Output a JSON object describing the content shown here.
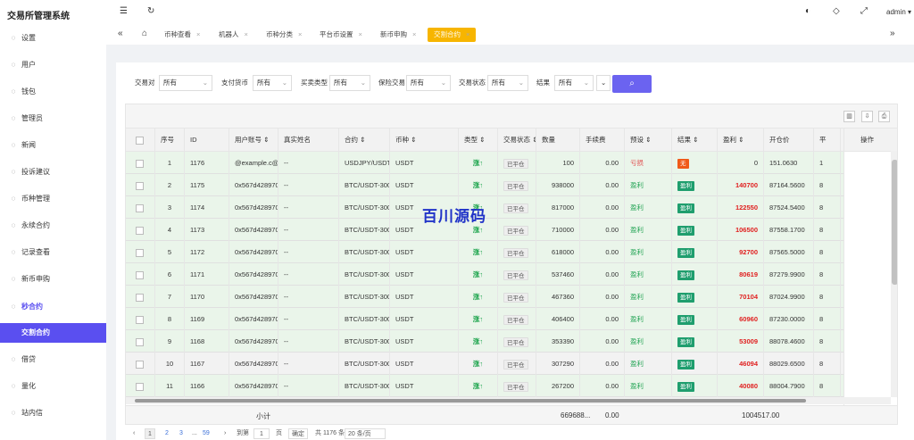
{
  "app": {
    "title": "交易所管理系统",
    "user": "admin"
  },
  "sidebar": {
    "items": [
      {
        "label": "设置",
        "icon": "gear-icon"
      },
      {
        "label": "用户",
        "icon": "user-icon"
      },
      {
        "label": "钱包",
        "icon": "wallet-icon"
      },
      {
        "label": "管理员",
        "icon": "shield-icon"
      },
      {
        "label": "新闻",
        "icon": "news-icon"
      },
      {
        "label": "投诉建议",
        "icon": "feedback-icon"
      },
      {
        "label": "币种管理",
        "icon": "coin-icon"
      },
      {
        "label": "永续合约",
        "icon": "contract-icon"
      },
      {
        "label": "记录查看",
        "icon": "record-icon"
      },
      {
        "label": "新币申购",
        "icon": "newcoin-icon"
      },
      {
        "label": "秒合约",
        "icon": "clock-icon"
      },
      {
        "label": "交割合约",
        "icon": ""
      },
      {
        "label": "借贷",
        "icon": "loan-icon"
      },
      {
        "label": "量化",
        "icon": "quant-icon"
      },
      {
        "label": "站内信",
        "icon": "mail-icon"
      }
    ]
  },
  "tabs": [
    {
      "label": "币种查看"
    },
    {
      "label": "机器人"
    },
    {
      "label": "币种分类"
    },
    {
      "label": "平台币设置"
    },
    {
      "label": "新币申购"
    },
    {
      "label": "交割合约"
    }
  ],
  "filters": [
    {
      "label": "交易对",
      "value": "所有"
    },
    {
      "label": "支付货币",
      "value": "所有"
    },
    {
      "label": "买卖类型",
      "value": "所有"
    },
    {
      "label": "保险交易",
      "value": "所有"
    },
    {
      "label": "交易状态",
      "value": "所有"
    },
    {
      "label": "结果",
      "value": "所有"
    }
  ],
  "table": {
    "columns": [
      "序号",
      "ID",
      "用户账号 ⇕",
      "真实姓名",
      "合约 ⇕",
      "币种 ⇕",
      "类型 ⇕",
      "交易状态 ⇕",
      "数量",
      "手续费",
      "预设 ⇕",
      "结果 ⇕",
      "盈利 ⇕",
      "开仓价",
      "平"
    ],
    "op_column": "操作",
    "rows": [
      {
        "n": "1",
        "id": "1176",
        "user": "@example.c@...",
        "name": "--",
        "contract": "USDJPY/USDT-...",
        "coin": "USDT",
        "type": "涨↑",
        "status": "已平仓",
        "qty": "100",
        "fee": "0.00",
        "preset": "亏损",
        "result": "无",
        "profit": "0",
        "open": "151.0630",
        "close": "1"
      },
      {
        "n": "2",
        "id": "1175",
        "user": "0x567d428970...",
        "name": "--",
        "contract": "BTC/USDT-300",
        "coin": "USDT",
        "type": "涨↑",
        "status": "已平仓",
        "qty": "938000",
        "fee": "0.00",
        "preset": "盈利",
        "result": "盈利",
        "profit": "140700",
        "open": "87164.5600",
        "close": "8"
      },
      {
        "n": "3",
        "id": "1174",
        "user": "0x567d428970...",
        "name": "--",
        "contract": "BTC/USDT-300",
        "coin": "USDT",
        "type": "涨↑",
        "status": "已平仓",
        "qty": "817000",
        "fee": "0.00",
        "preset": "盈利",
        "result": "盈利",
        "profit": "122550",
        "open": "87524.5400",
        "close": "8"
      },
      {
        "n": "4",
        "id": "1173",
        "user": "0x567d428970...",
        "name": "--",
        "contract": "BTC/USDT-300",
        "coin": "USDT",
        "type": "涨↑",
        "status": "已平仓",
        "qty": "710000",
        "fee": "0.00",
        "preset": "盈利",
        "result": "盈利",
        "profit": "106500",
        "open": "87558.1700",
        "close": "8"
      },
      {
        "n": "5",
        "id": "1172",
        "user": "0x567d428970...",
        "name": "--",
        "contract": "BTC/USDT-300",
        "coin": "USDT",
        "type": "涨↑",
        "status": "已平仓",
        "qty": "618000",
        "fee": "0.00",
        "preset": "盈利",
        "result": "盈利",
        "profit": "92700",
        "open": "87565.5000",
        "close": "8"
      },
      {
        "n": "6",
        "id": "1171",
        "user": "0x567d428970...",
        "name": "--",
        "contract": "BTC/USDT-300",
        "coin": "USDT",
        "type": "涨↑",
        "status": "已平仓",
        "qty": "537460",
        "fee": "0.00",
        "preset": "盈利",
        "result": "盈利",
        "profit": "80619",
        "open": "87279.9900",
        "close": "8"
      },
      {
        "n": "7",
        "id": "1170",
        "user": "0x567d428970...",
        "name": "--",
        "contract": "BTC/USDT-300",
        "coin": "USDT",
        "type": "涨↑",
        "status": "已平仓",
        "qty": "467360",
        "fee": "0.00",
        "preset": "盈利",
        "result": "盈利",
        "profit": "70104",
        "open": "87024.9900",
        "close": "8"
      },
      {
        "n": "8",
        "id": "1169",
        "user": "0x567d428970...",
        "name": "--",
        "contract": "BTC/USDT-300",
        "coin": "USDT",
        "type": "涨↑",
        "status": "已平仓",
        "qty": "406400",
        "fee": "0.00",
        "preset": "盈利",
        "result": "盈利",
        "profit": "60960",
        "open": "87230.0000",
        "close": "8"
      },
      {
        "n": "9",
        "id": "1168",
        "user": "0x567d428970...",
        "name": "--",
        "contract": "BTC/USDT-300",
        "coin": "USDT",
        "type": "涨↑",
        "status": "已平仓",
        "qty": "353390",
        "fee": "0.00",
        "preset": "盈利",
        "result": "盈利",
        "profit": "53009",
        "open": "88078.4600",
        "close": "8"
      },
      {
        "n": "10",
        "id": "1167",
        "user": "0x567d428970...",
        "name": "--",
        "contract": "BTC/USDT-300",
        "coin": "USDT",
        "type": "涨↑",
        "status": "已平仓",
        "qty": "307290",
        "fee": "0.00",
        "preset": "盈利",
        "result": "盈利",
        "profit": "46094",
        "open": "88029.6500",
        "close": "8"
      },
      {
        "n": "11",
        "id": "1166",
        "user": "0x567d428970...",
        "name": "--",
        "contract": "BTC/USDT-300",
        "coin": "USDT",
        "type": "涨↑",
        "status": "已平仓",
        "qty": "267200",
        "fee": "0.00",
        "preset": "盈利",
        "result": "盈利",
        "profit": "40080",
        "open": "88004.7900",
        "close": "8"
      }
    ],
    "totals": {
      "label": "小计",
      "qty": "669688...",
      "fee": "0.00",
      "profit": "1004517.00"
    }
  },
  "pager": {
    "pages": [
      "1",
      "2",
      "3",
      "...",
      "59"
    ],
    "goto_label": "到第",
    "goto_value": "1",
    "page_unit": "页",
    "confirm": "确定",
    "total": "共 1176 条",
    "page_size": "20 条/页"
  },
  "watermark": "百川源码",
  "colors": {
    "accent": "#5a4ff0",
    "tab_active": "#f7b500",
    "profit": "#e02020",
    "up": "#1aa34a"
  }
}
